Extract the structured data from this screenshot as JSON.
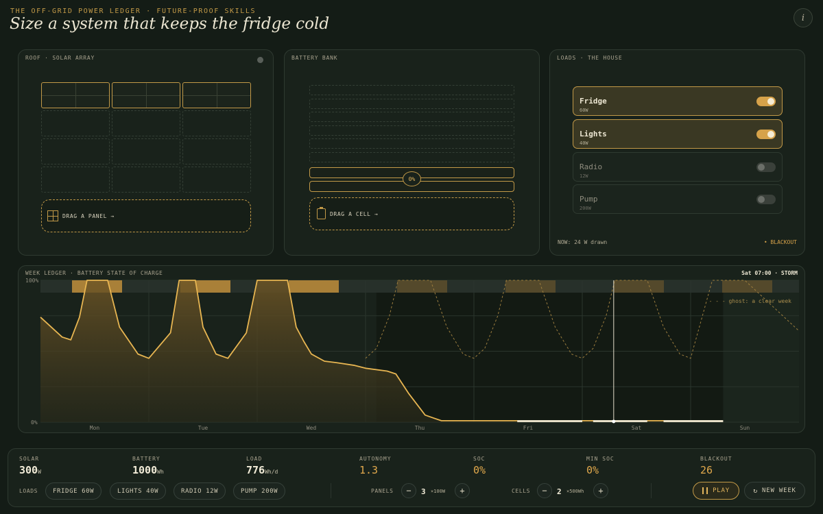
{
  "header": {
    "kicker": "THE OFF-GRID POWER LEDGER · FUTURE-PROOF SKILLS",
    "title": "Size a system that keeps the fridge cold",
    "info_label": "i"
  },
  "roof": {
    "title": "ROOF · SOLAR ARRAY",
    "drag_label": "DRAG A PANEL →",
    "slots_total": 12,
    "slots_filled": 3
  },
  "battery": {
    "title": "BATTERY BANK",
    "soc_label": "0%",
    "drag_label": "DRAG A CELL →",
    "cells": 2
  },
  "loads": {
    "title": "LOADS · THE HOUSE",
    "items": [
      {
        "name": "Fridge",
        "watts": "60W",
        "on": true
      },
      {
        "name": "Lights",
        "watts": "40W",
        "on": true
      },
      {
        "name": "Radio",
        "watts": "12W",
        "on": false
      },
      {
        "name": "Pump",
        "watts": "200W",
        "on": false
      }
    ],
    "now_drawn": "NOW: 24 W drawn",
    "blackout_flag": "• BLACKOUT"
  },
  "ledger": {
    "title": "WEEK LEDGER · BATTERY STATE OF CHARGE",
    "status": "Sat 07:00 · STORM",
    "legend": "- - -  ghost: a clear week",
    "y_top": "100%",
    "y_bottom": "0%",
    "days": [
      "Mon",
      "Tue",
      "Wed",
      "Thu",
      "Fri",
      "Sat",
      "Sun"
    ]
  },
  "chart_data": {
    "type": "area",
    "title": "WEEK LEDGER · BATTERY STATE OF CHARGE",
    "ylim": [
      0,
      100
    ],
    "x_days": [
      "Mon",
      "Tue",
      "Wed",
      "Thu",
      "Fri",
      "Sat",
      "Sun"
    ],
    "cursor": "Sat 07:00",
    "series": [
      {
        "name": "",
        "x_days": [
          0,
          0.2,
          0.28,
          0.36,
          0.43,
          0.5,
          0.62,
          0.73,
          0.9,
          1.0,
          1.2,
          1.28,
          1.36,
          1.43,
          1.5,
          1.62,
          1.73,
          1.9,
          2.0,
          2.2,
          2.28,
          2.36,
          2.43,
          2.5,
          2.62,
          2.73,
          2.9,
          3.0,
          3.2,
          3.28,
          3.4,
          3.55,
          3.7,
          3.85,
          4.0,
          4.5,
          5.0,
          5.5,
          6.0
        ],
        "values": [
          74,
          60,
          58,
          74,
          100,
          100,
          100,
          67,
          48,
          45,
          63,
          100,
          100,
          100,
          67,
          48,
          45,
          63,
          100,
          100,
          100,
          67,
          57,
          48,
          43,
          42,
          40,
          38,
          36,
          34,
          20,
          5,
          1,
          1,
          1,
          1,
          1,
          1,
          1
        ]
      },
      {
        "name": "ghost: a clear week",
        "x_days": [
          3.0,
          3.1,
          3.22,
          3.3,
          3.45,
          3.6,
          3.75,
          3.9,
          4.0,
          4.1,
          4.22,
          4.3,
          4.45,
          4.6,
          4.75,
          4.9,
          5.0,
          5.1,
          5.22,
          5.3,
          5.45,
          5.6,
          5.75,
          5.9,
          6.0,
          6.2,
          6.5,
          6.99
        ],
        "values": [
          45,
          52,
          75,
          100,
          100,
          100,
          67,
          48,
          45,
          52,
          75,
          100,
          100,
          100,
          67,
          48,
          45,
          52,
          75,
          100,
          100,
          100,
          67,
          48,
          45,
          100,
          100,
          65
        ]
      }
    ]
  },
  "stats": {
    "solar": {
      "label": "SOLAR",
      "value": "300",
      "unit": "W"
    },
    "battery": {
      "label": "BATTERY",
      "value": "1000",
      "unit": "Wh"
    },
    "load": {
      "label": "LOAD",
      "value": "776",
      "unit": "Wh/d"
    },
    "autonomy": {
      "label": "AUTONOMY",
      "value": "1.3"
    },
    "soc": {
      "label": "SOC",
      "value": "0%"
    },
    "min_soc": {
      "label": "MIN SOC",
      "value": "0%"
    },
    "blackout": {
      "label": "BLACKOUT",
      "value": "26"
    }
  },
  "controls": {
    "loads_label": "LOADS",
    "chips": [
      "FRIDGE 60W",
      "LIGHTS 40W",
      "RADIO 12W",
      "PUMP 200W"
    ],
    "panels_label": "PANELS",
    "panels_value": "3",
    "panels_unit": "×100W",
    "cells_label": "CELLS",
    "cells_value": "2",
    "cells_unit": "×500Wh",
    "minus": "−",
    "plus": "+",
    "play_label": "PLAY",
    "new_week_label": "NEW WEEK"
  },
  "colors": {
    "accent": "#c39a48",
    "background": "#141c16",
    "panel": "#19221b"
  }
}
